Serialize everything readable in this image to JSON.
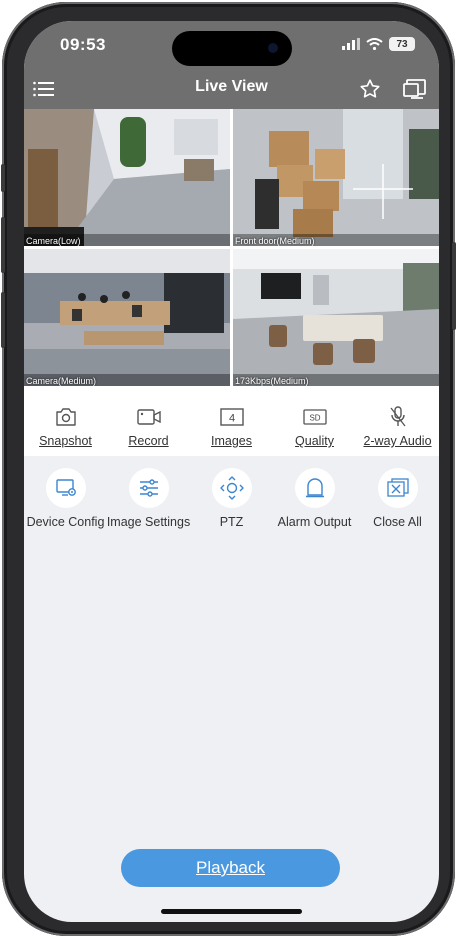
{
  "status": {
    "time": "09:53",
    "battery": "73"
  },
  "nav": {
    "title": "Live View",
    "menu_icon": "hamburger-menu-icon",
    "favorite_icon": "star-icon",
    "multiscreen_icon": "add-screen-icon"
  },
  "cameras": [
    {
      "label": "Camera(Low)"
    },
    {
      "label": "Front door(Medium)"
    },
    {
      "label": "Camera(Medium)"
    },
    {
      "label": "173Kbps(Medium)"
    }
  ],
  "toolbar": [
    {
      "label": "Snapshot",
      "icon": "camera-icon"
    },
    {
      "label": "Record",
      "icon": "video-record-icon"
    },
    {
      "label": "Images",
      "icon": "grid-count-icon",
      "badge": "4"
    },
    {
      "label": "Quality",
      "icon": "sd-quality-icon",
      "badge": "SD"
    },
    {
      "label": "2-way Audio",
      "icon": "microphone-icon"
    }
  ],
  "functions": [
    {
      "label": "Device Config",
      "icon": "device-config-icon"
    },
    {
      "label": "Image Settings",
      "icon": "sliders-icon"
    },
    {
      "label": "PTZ",
      "icon": "ptz-arrows-icon"
    },
    {
      "label": "Alarm Output",
      "icon": "alarm-icon"
    },
    {
      "label": "Close All",
      "icon": "close-all-icon"
    }
  ],
  "playback": {
    "label": "Playback"
  },
  "colors": {
    "header": "#6f6f6f",
    "accent": "#4a98e0",
    "icon": "#3b86cf",
    "background": "#eef0f3"
  }
}
